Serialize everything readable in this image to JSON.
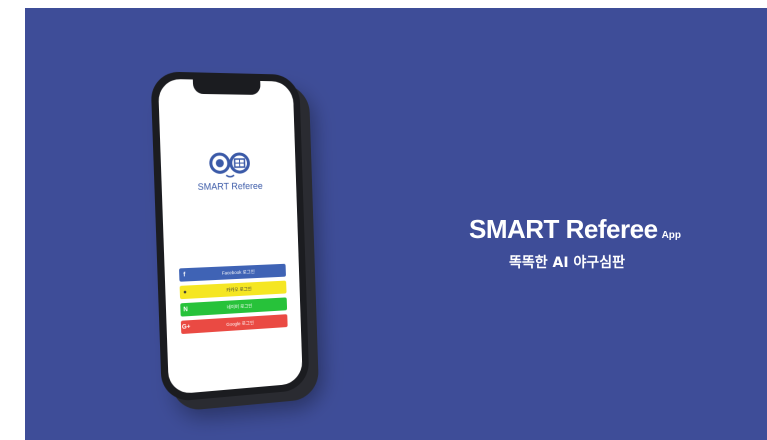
{
  "app": {
    "name": "SMART Referee",
    "headline": "SMART Referee",
    "headline_suffix": "App",
    "tagline": "똑똑한 AI 야구심판"
  },
  "login_buttons": [
    {
      "icon": "facebook-icon",
      "glyph": "f",
      "label": "Facebook 로그인",
      "color": "#3f63b5"
    },
    {
      "icon": "kakao-icon",
      "glyph": "●",
      "label": "카카오 로그인",
      "color": "#f5e623"
    },
    {
      "icon": "naver-icon",
      "glyph": "N",
      "label": "네이버 로그인",
      "color": "#27c23a"
    },
    {
      "icon": "google-icon",
      "glyph": "G+",
      "label": "Google 로그인",
      "color": "#ea4a43"
    }
  ],
  "colors": {
    "background": "#3e4d98",
    "brand_blue": "#3b5aa8"
  }
}
